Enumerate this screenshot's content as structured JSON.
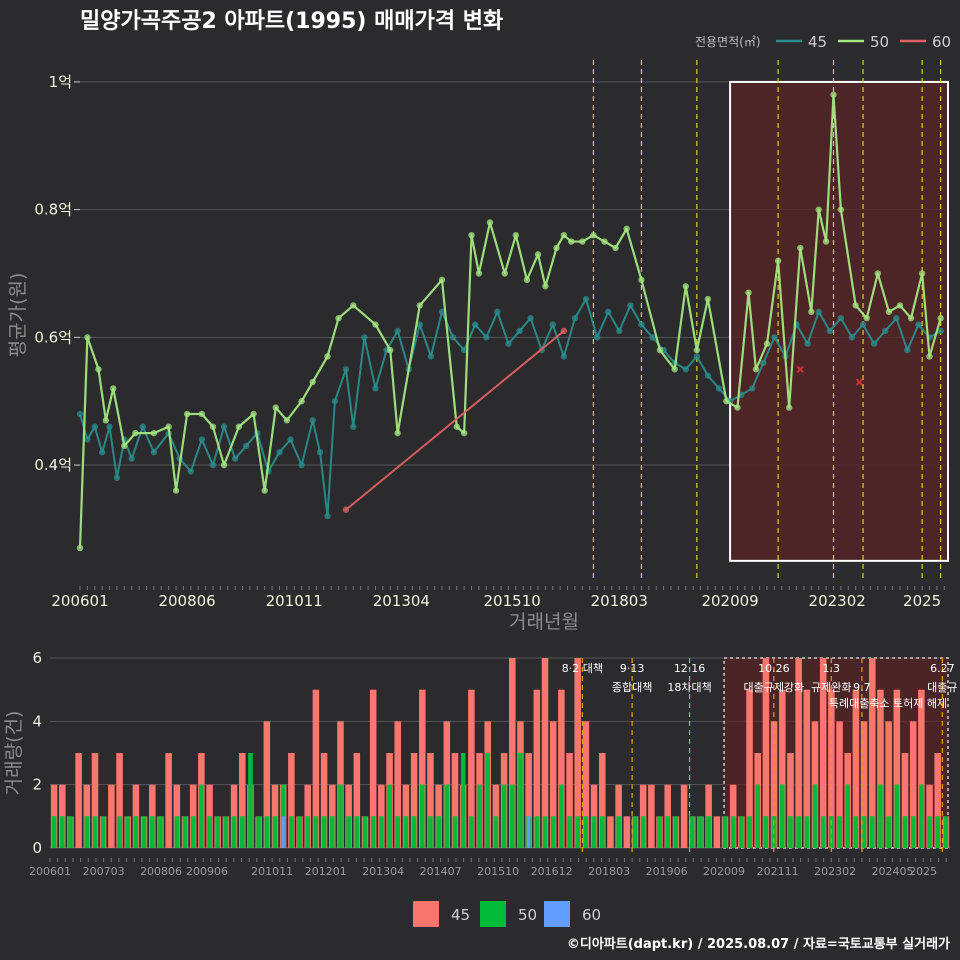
{
  "title": "밀양가곡주공2 아파트(1995) 매매가격 변화",
  "credit": "©디아파트(dapt.kr) / 2025.08.07 / 자료=국토교통부 실거래가",
  "colors": {
    "bg": "#2b2b2d",
    "grid": "#555558",
    "s45": "#2a8c8c",
    "s50": "#a3e680",
    "s60": "#e06060",
    "bar45": "#f8766d",
    "bar50": "#00ba38",
    "bar60": "#619cff",
    "vline": "#d8d020",
    "vline_bottom": "#e0a000",
    "highlight_fill": "#5a2424",
    "highlight_border": "#ffffff"
  },
  "chart_data": [
    {
      "type": "line",
      "name": "price",
      "xlabel": "거래년월",
      "ylabel": "평균가(원)",
      "x_range": [
        "2006-01",
        "2025-08"
      ],
      "ylim": [
        0.22,
        1.05
      ],
      "x_ticks": [
        "200601",
        "200806",
        "201011",
        "201304",
        "201510",
        "201803",
        "202009",
        "202302",
        "2025"
      ],
      "y_ticks": [
        {
          "value": 0.4,
          "label": "0.4억"
        },
        {
          "value": 0.6,
          "label": "0.6억"
        },
        {
          "value": 0.8,
          "label": "0.8억"
        },
        {
          "value": 1.0,
          "label": "1억"
        }
      ],
      "legend_title": "전용면적(㎡)",
      "legend_position": "top-right",
      "highlight_range": [
        "2020-09",
        "2025-08"
      ],
      "policy_lines": [
        "2017-08",
        "2018-09",
        "2019-12",
        "2021-10",
        "2023-01",
        "2023-09",
        "2025-01",
        "2025-06"
      ],
      "series": [
        {
          "name": "45",
          "points": [
            [
              "2006-01",
              0.48
            ],
            [
              "2006-03",
              0.44
            ],
            [
              "2006-05",
              0.46
            ],
            [
              "2006-07",
              0.42
            ],
            [
              "2006-09",
              0.46
            ],
            [
              "2006-11",
              0.38
            ],
            [
              "2007-01",
              0.44
            ],
            [
              "2007-03",
              0.41
            ],
            [
              "2007-06",
              0.46
            ],
            [
              "2007-09",
              0.42
            ],
            [
              "2008-01",
              0.45
            ],
            [
              "2008-04",
              0.41
            ],
            [
              "2008-07",
              0.39
            ],
            [
              "2008-10",
              0.44
            ],
            [
              "2009-01",
              0.4
            ],
            [
              "2009-04",
              0.46
            ],
            [
              "2009-07",
              0.41
            ],
            [
              "2009-10",
              0.43
            ],
            [
              "2010-01",
              0.45
            ],
            [
              "2010-04",
              0.39
            ],
            [
              "2010-07",
              0.42
            ],
            [
              "2010-10",
              0.44
            ],
            [
              "2011-01",
              0.4
            ],
            [
              "2011-04",
              0.47
            ],
            [
              "2011-06",
              0.42
            ],
            [
              "2011-08",
              0.32
            ],
            [
              "2011-10",
              0.5
            ],
            [
              "2012-01",
              0.55
            ],
            [
              "2012-03",
              0.46
            ],
            [
              "2012-06",
              0.6
            ],
            [
              "2012-09",
              0.52
            ],
            [
              "2012-12",
              0.58
            ],
            [
              "2013-03",
              0.61
            ],
            [
              "2013-06",
              0.55
            ],
            [
              "2013-09",
              0.62
            ],
            [
              "2013-12",
              0.57
            ],
            [
              "2014-03",
              0.64
            ],
            [
              "2014-06",
              0.6
            ],
            [
              "2014-09",
              0.58
            ],
            [
              "2014-12",
              0.62
            ],
            [
              "2015-03",
              0.6
            ],
            [
              "2015-06",
              0.64
            ],
            [
              "2015-09",
              0.59
            ],
            [
              "2015-12",
              0.61
            ],
            [
              "2016-03",
              0.63
            ],
            [
              "2016-06",
              0.58
            ],
            [
              "2016-09",
              0.62
            ],
            [
              "2016-12",
              0.57
            ],
            [
              "2017-03",
              0.63
            ],
            [
              "2017-06",
              0.66
            ],
            [
              "2017-09",
              0.6
            ],
            [
              "2017-12",
              0.64
            ],
            [
              "2018-03",
              0.61
            ],
            [
              "2018-06",
              0.65
            ],
            [
              "2018-09",
              0.62
            ],
            [
              "2018-12",
              0.6
            ],
            [
              "2019-03",
              0.58
            ],
            [
              "2019-06",
              0.56
            ],
            [
              "2019-09",
              0.55
            ],
            [
              "2019-12",
              0.57
            ],
            [
              "2020-03",
              0.54
            ],
            [
              "2020-06",
              0.52
            ],
            [
              "2020-09",
              0.5
            ],
            [
              "2020-12",
              0.51
            ],
            [
              "2021-03",
              0.52
            ],
            [
              "2021-06",
              0.56
            ],
            [
              "2021-09",
              0.6
            ],
            [
              "2021-12",
              0.57
            ],
            [
              "2022-03",
              0.62
            ],
            [
              "2022-06",
              0.59
            ],
            [
              "2022-09",
              0.64
            ],
            [
              "2022-12",
              0.61
            ],
            [
              "2023-03",
              0.63
            ],
            [
              "2023-06",
              0.6
            ],
            [
              "2023-09",
              0.62
            ],
            [
              "2023-12",
              0.59
            ],
            [
              "2024-03",
              0.61
            ],
            [
              "2024-06",
              0.63
            ],
            [
              "2024-09",
              0.58
            ],
            [
              "2024-12",
              0.62
            ],
            [
              "2025-03",
              0.6
            ],
            [
              "2025-06",
              0.61
            ]
          ]
        },
        {
          "name": "50",
          "points": [
            [
              "2006-01",
              0.27
            ],
            [
              "2006-03",
              0.6
            ],
            [
              "2006-06",
              0.55
            ],
            [
              "2006-08",
              0.47
            ],
            [
              "2006-10",
              0.52
            ],
            [
              "2007-01",
              0.43
            ],
            [
              "2007-04",
              0.45
            ],
            [
              "2007-09",
              0.45
            ],
            [
              "2008-01",
              0.46
            ],
            [
              "2008-03",
              0.36
            ],
            [
              "2008-06",
              0.48
            ],
            [
              "2008-10",
              0.48
            ],
            [
              "2009-01",
              0.46
            ],
            [
              "2009-04",
              0.4
            ],
            [
              "2009-08",
              0.46
            ],
            [
              "2009-12",
              0.48
            ],
            [
              "2010-03",
              0.36
            ],
            [
              "2010-06",
              0.49
            ],
            [
              "2010-09",
              0.47
            ],
            [
              "2011-01",
              0.5
            ],
            [
              "2011-04",
              0.53
            ],
            [
              "2011-08",
              0.57
            ],
            [
              "2011-11",
              0.63
            ],
            [
              "2012-03",
              0.65
            ],
            [
              "2012-09",
              0.62
            ],
            [
              "2013-01",
              0.58
            ],
            [
              "2013-03",
              0.45
            ],
            [
              "2013-09",
              0.65
            ],
            [
              "2014-03",
              0.69
            ],
            [
              "2014-07",
              0.46
            ],
            [
              "2014-09",
              0.45
            ],
            [
              "2014-11",
              0.76
            ],
            [
              "2015-01",
              0.7
            ],
            [
              "2015-04",
              0.78
            ],
            [
              "2015-08",
              0.7
            ],
            [
              "2015-11",
              0.76
            ],
            [
              "2016-02",
              0.69
            ],
            [
              "2016-05",
              0.73
            ],
            [
              "2016-07",
              0.68
            ],
            [
              "2016-10",
              0.74
            ],
            [
              "2016-12",
              0.76
            ],
            [
              "2017-02",
              0.75
            ],
            [
              "2017-05",
              0.75
            ],
            [
              "2017-08",
              0.76
            ],
            [
              "2017-11",
              0.75
            ],
            [
              "2018-02",
              0.74
            ],
            [
              "2018-05",
              0.77
            ],
            [
              "2018-09",
              0.69
            ],
            [
              "2019-02",
              0.58
            ],
            [
              "2019-06",
              0.55
            ],
            [
              "2019-09",
              0.68
            ],
            [
              "2019-12",
              0.58
            ],
            [
              "2020-03",
              0.66
            ],
            [
              "2020-08",
              0.5
            ],
            [
              "2020-11",
              0.49
            ],
            [
              "2021-02",
              0.67
            ],
            [
              "2021-04",
              0.55
            ],
            [
              "2021-07",
              0.59
            ],
            [
              "2021-10",
              0.72
            ],
            [
              "2022-01",
              0.49
            ],
            [
              "2022-04",
              0.74
            ],
            [
              "2022-07",
              0.64
            ],
            [
              "2022-09",
              0.8
            ],
            [
              "2022-11",
              0.75
            ],
            [
              "2023-01",
              0.98
            ],
            [
              "2023-03",
              0.8
            ],
            [
              "2023-07",
              0.65
            ],
            [
              "2023-10",
              0.63
            ],
            [
              "2024-01",
              0.7
            ],
            [
              "2024-04",
              0.64
            ],
            [
              "2024-07",
              0.65
            ],
            [
              "2024-10",
              0.63
            ],
            [
              "2025-01",
              0.7
            ],
            [
              "2025-03",
              0.57
            ],
            [
              "2025-06",
              0.63
            ]
          ]
        },
        {
          "name": "60",
          "points": [
            [
              "2012-01",
              0.33
            ],
            [
              "2016-12",
              0.61
            ]
          ],
          "markers_x": [
            [
              "2022-04",
              0.55
            ],
            [
              "2023-08",
              0.53
            ]
          ]
        }
      ]
    },
    {
      "type": "bar",
      "name": "volume",
      "ylabel": "거래량(건)",
      "ylim": [
        0,
        6
      ],
      "y_ticks": [
        0,
        2,
        4,
        6
      ],
      "x_ticks": [
        "200601",
        "200703",
        "200806",
        "200906",
        "201011",
        "201201",
        "201304",
        "201407",
        "201510",
        "201612",
        "201803",
        "201906",
        "202009",
        "202111",
        "202302",
        "202405",
        "2025"
      ],
      "legend": [
        "45",
        "50",
        "60"
      ],
      "legend_position": "bottom",
      "annotations": [
        {
          "date": "2017-08",
          "line1": "8·2 대책",
          "line2": ""
        },
        {
          "date": "2018-09",
          "line1": "9·13",
          "line2": "종합대책"
        },
        {
          "date": "2019-12",
          "line1": "12·16",
          "line2": "18차대책"
        },
        {
          "date": "2021-10",
          "line1": "10.26",
          "line2": "대출규제강화"
        },
        {
          "date": "2023-01",
          "line1": "1.3",
          "line2": "규제완화"
        },
        {
          "date": "2023-09",
          "line1": "",
          "line2": "9.7"
        },
        {
          "date": "2025-06",
          "line1": "6.27",
          "line2": "대출규"
        }
      ],
      "annotation_line3": "특례대출축소 토허제 해제",
      "bars": {
        "45": [
          2,
          2,
          1,
          3,
          2,
          3,
          1,
          2,
          3,
          1,
          2,
          1,
          2,
          1,
          3,
          2,
          1,
          2,
          3,
          2,
          1,
          1,
          2,
          3,
          2,
          1,
          4,
          2,
          2,
          3,
          1,
          2,
          5,
          3,
          2,
          4,
          2,
          3,
          1,
          5,
          2,
          3,
          4,
          2,
          3,
          5,
          3,
          2,
          4,
          3,
          2,
          5,
          3,
          4,
          2,
          3,
          6,
          4,
          3,
          5,
          6,
          4,
          5,
          3,
          6,
          4,
          2,
          3,
          1,
          2,
          1,
          1,
          2,
          2,
          1,
          2,
          1,
          2,
          1,
          1,
          2,
          1,
          1,
          2,
          1,
          5,
          3,
          6,
          4,
          5,
          3,
          6,
          5,
          4,
          6,
          5,
          4,
          3,
          5,
          4,
          6,
          5,
          4,
          5,
          3,
          4,
          5,
          2,
          3,
          1
        ],
        "50": [
          1,
          1,
          1,
          0,
          1,
          1,
          1,
          0,
          1,
          1,
          1,
          1,
          1,
          1,
          0,
          1,
          1,
          1,
          2,
          1,
          1,
          1,
          1,
          1,
          3,
          1,
          1,
          1,
          2,
          1,
          1,
          1,
          1,
          1,
          1,
          2,
          1,
          1,
          1,
          1,
          1,
          2,
          1,
          1,
          1,
          2,
          1,
          1,
          2,
          1,
          3,
          1,
          2,
          3,
          1,
          2,
          2,
          3,
          1,
          1,
          1,
          1,
          2,
          1,
          1,
          1,
          1,
          1,
          0,
          1,
          0,
          1,
          1,
          0,
          1,
          1,
          1,
          0,
          1,
          1,
          1,
          0,
          1,
          1,
          1,
          1,
          2,
          1,
          1,
          2,
          1,
          1,
          1,
          2,
          1,
          1,
          1,
          2,
          1,
          1,
          1,
          2,
          1,
          2,
          1,
          1,
          2,
          1,
          1,
          1
        ],
        "60": [
          0,
          0,
          0,
          0,
          0,
          0,
          0,
          0,
          0,
          0,
          0,
          0,
          0,
          0,
          0,
          0,
          0,
          0,
          0,
          0,
          0,
          0,
          0,
          0,
          0,
          0,
          0,
          0,
          1,
          0,
          0,
          0,
          0,
          0,
          0,
          0,
          0,
          0,
          0,
          0,
          0,
          0,
          0,
          0,
          0,
          0,
          0,
          0,
          0,
          0,
          0,
          0,
          0,
          0,
          0,
          0,
          0,
          0,
          1,
          0,
          0,
          0,
          0,
          0,
          0,
          0,
          0,
          0,
          0,
          0,
          0,
          0,
          0,
          0,
          0,
          0,
          0,
          0,
          0,
          0,
          0,
          0,
          0,
          0,
          0,
          0,
          0,
          0,
          0,
          0,
          0,
          0,
          0,
          0,
          0,
          0,
          0,
          0,
          0,
          0,
          0,
          0,
          0,
          0,
          0,
          0,
          0,
          0,
          0,
          0
        ]
      }
    }
  ]
}
